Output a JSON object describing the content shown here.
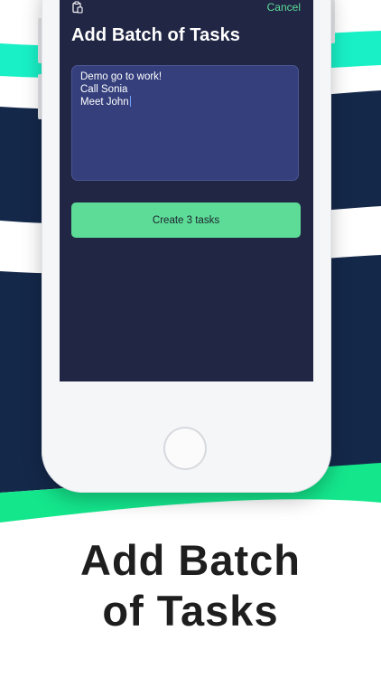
{
  "colors": {
    "stripe_teal": "#19f0c6",
    "stripe_navy": "#14284a",
    "stripe_green": "#14e68c",
    "screen_bg": "#212644",
    "accent_green": "#5cdc96",
    "textbox_bg": "#343f7c"
  },
  "screen": {
    "clipboard_icon": "clipboard-icon",
    "cancel_label": "Cancel",
    "title": "Add Batch of Tasks",
    "textarea_lines": [
      "Demo go to work!",
      "Call Sonia",
      "Meet John"
    ],
    "create_button_label": "Create 3 tasks"
  },
  "caption": {
    "line1": "Add Batch",
    "line2": "of Tasks"
  }
}
